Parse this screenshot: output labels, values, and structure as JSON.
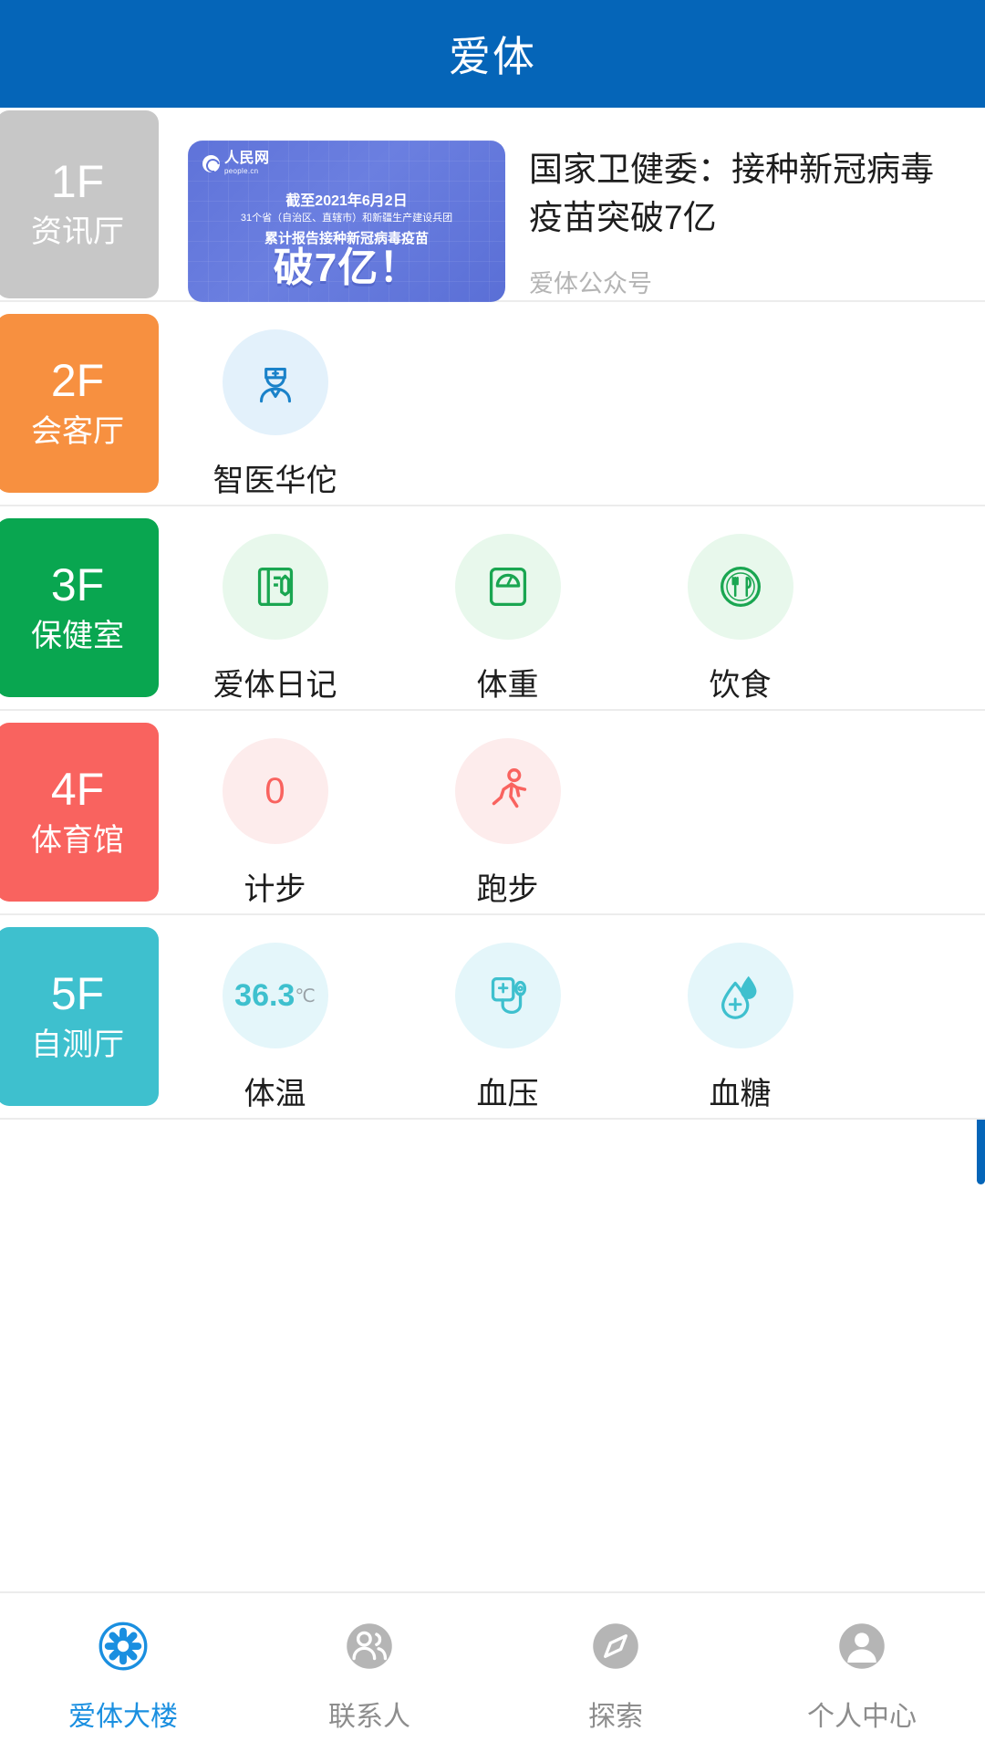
{
  "header": {
    "title": "爱体"
  },
  "colors": {
    "header_bg": "#0565b8",
    "floor1": "#c7c7c7",
    "floor2": "#f79040",
    "floor3": "#09a650",
    "floor4": "#f9635f",
    "floor5": "#3ec0ce",
    "active_tab": "#1a8fe0"
  },
  "floors": [
    {
      "num": "1F",
      "name": "资讯厅",
      "color": "#c7c7c7",
      "type": "news",
      "news": {
        "thumb": {
          "logo_cn": "人民网",
          "logo_en": "people.cn",
          "date_line": "截至2021年6月2日",
          "sub_line": "31个省（自治区、直辖市）和新疆生产建设兵团",
          "body_line": "累计报告接种新冠病毒疫苗",
          "headline": "破7亿！"
        },
        "title": "国家卫健委：接种新冠病毒疫苗突破7亿",
        "source": "爱体公众号"
      }
    },
    {
      "num": "2F",
      "name": "会客厅",
      "color": "#f79040",
      "type": "tiles",
      "tiles": [
        {
          "label": "智医华佗",
          "icon": "doctor-icon",
          "icon_color": "#1a82c9",
          "bg": "#e3f1fb",
          "value": ""
        }
      ]
    },
    {
      "num": "3F",
      "name": "保健室",
      "color": "#09a650",
      "type": "tiles",
      "tiles": [
        {
          "label": "爱体日记",
          "icon": "notebook-icon",
          "icon_color": "#1aa651",
          "bg": "#e8f8ec",
          "value": ""
        },
        {
          "label": "体重",
          "icon": "scale-icon",
          "icon_color": "#1aa651",
          "bg": "#e8f8ec",
          "value": ""
        },
        {
          "label": "饮食",
          "icon": "plate-cutlery-icon",
          "icon_color": "#1aa651",
          "bg": "#e8f8ec",
          "value": ""
        }
      ]
    },
    {
      "num": "4F",
      "name": "体育馆",
      "color": "#f9635f",
      "type": "tiles",
      "tiles": [
        {
          "label": "计步",
          "icon": "step-count-value",
          "icon_color": "#f9635f",
          "bg": "#fdecec",
          "value": "0"
        },
        {
          "label": "跑步",
          "icon": "running-person-icon",
          "icon_color": "#f9635f",
          "bg": "#fdecec",
          "value": ""
        }
      ]
    },
    {
      "num": "5F",
      "name": "自测厅",
      "color": "#3ec0ce",
      "type": "tiles",
      "tiles": [
        {
          "label": "体温",
          "icon": "temperature-value",
          "icon_color": "#3ec0ce",
          "bg": "#e4f6fa",
          "value": "36.3",
          "unit": "℃"
        },
        {
          "label": "血压",
          "icon": "blood-pressure-icon",
          "icon_color": "#3ec0ce",
          "bg": "#e4f6fa",
          "value": ""
        },
        {
          "label": "血糖",
          "icon": "blood-glucose-icon",
          "icon_color": "#3ec0ce",
          "bg": "#e4f6fa",
          "value": ""
        }
      ]
    }
  ],
  "tabbar": [
    {
      "label": "爱体大楼",
      "icon": "building-snowflake-icon",
      "active": true
    },
    {
      "label": "联系人",
      "icon": "contacts-icon",
      "active": false
    },
    {
      "label": "探索",
      "icon": "compass-icon",
      "active": false
    },
    {
      "label": "个人中心",
      "icon": "profile-icon",
      "active": false
    }
  ]
}
